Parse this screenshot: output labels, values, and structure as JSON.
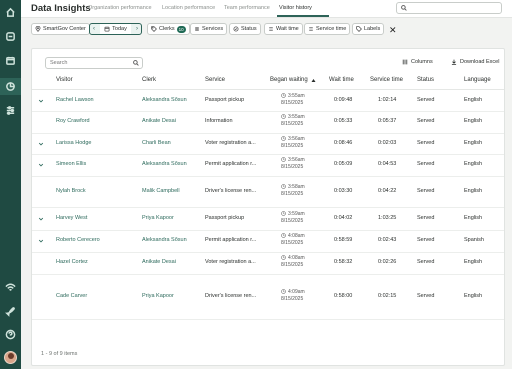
{
  "app": {
    "title": "Data Insights"
  },
  "tabs": [
    {
      "label": "Organization performance",
      "active": false
    },
    {
      "label": "Location performance",
      "active": false
    },
    {
      "label": "Team performance",
      "active": false
    },
    {
      "label": "Visitor history",
      "active": true
    }
  ],
  "filters": {
    "location": "SmartGov Center",
    "date": "Today",
    "clerks_label": "Clerks",
    "clerks_count": "10",
    "services": "Services",
    "status": "Status",
    "wait_time": "Wait time",
    "service_time": "Service time",
    "labels": "Labels",
    "clear": "✕"
  },
  "table_tools": {
    "search_placeholder": "Search",
    "columns_label": "Columns",
    "download_label": "Download Excel"
  },
  "columns": [
    "Visitor",
    "Clerk",
    "Service",
    "Began waiting",
    "Wait time",
    "Service time",
    "Status",
    "Language"
  ],
  "rows": [
    {
      "expandable": true,
      "visitor": "Rachel Lawson",
      "clerk": "Aleksandra Sõsun",
      "service": "Passport pickup",
      "time": "3:55am",
      "date": "8/15/2025",
      "wait": "0:09:48",
      "service_time": "1:02:14",
      "status": "Served",
      "language": "English"
    },
    {
      "expandable": false,
      "visitor": "Roy Crawford",
      "clerk": "Anikate Desai",
      "service": "Information",
      "time": "3:55am",
      "date": "8/15/2025",
      "wait": "0:05:33",
      "service_time": "0:05:37",
      "status": "Served",
      "language": "English"
    },
    {
      "expandable": true,
      "visitor": "Larissa Hodge",
      "clerk": "Charli Bean",
      "service": "Voter registration a...",
      "time": "3:56am",
      "date": "8/15/2025",
      "wait": "0:08:46",
      "service_time": "0:02:03",
      "status": "Served",
      "language": "English"
    },
    {
      "expandable": true,
      "visitor": "Simeon Ellis",
      "clerk": "Aleksandra Sõsun",
      "service": "Permit application r...",
      "time": "3:56am",
      "date": "8/15/2025",
      "wait": "0:05:09",
      "service_time": "0:04:53",
      "status": "Served",
      "language": "English"
    },
    {
      "expandable": false,
      "visitor": "Nylah Brock",
      "clerk": "Malik Campbell",
      "service": "Driver's license ren...",
      "time": "3:58am",
      "date": "8/15/2025",
      "wait": "0:03:30",
      "service_time": "0:04:22",
      "status": "Served",
      "language": "English"
    },
    {
      "expandable": true,
      "visitor": "Harvey West",
      "clerk": "Priya Kapoor",
      "service": "Passport pickup",
      "time": "3:59am",
      "date": "8/15/2025",
      "wait": "0:04:02",
      "service_time": "1:03:25",
      "status": "Served",
      "language": "English"
    },
    {
      "expandable": true,
      "visitor": "Roberto Cerecero",
      "clerk": "Aleksandra Sõsun",
      "service": "Permit application r...",
      "time": "4:08am",
      "date": "8/15/2025",
      "wait": "0:58:59",
      "service_time": "0:02:43",
      "status": "Served",
      "language": "Spanish"
    },
    {
      "expandable": false,
      "visitor": "Hazel Cortez",
      "clerk": "Anikate Desai",
      "service": "Voter registration a...",
      "time": "4:08am",
      "date": "8/15/2025",
      "wait": "0:58:32",
      "service_time": "0:02:26",
      "status": "Served",
      "language": "English"
    },
    {
      "expandable": false,
      "visitor": "Cade Carver",
      "clerk": "Priya Kapoor",
      "service": "Driver's license ren...",
      "time": "4:09am",
      "date": "8/15/2025",
      "wait": "0:58:00",
      "service_time": "0:02:15",
      "status": "Served",
      "language": "English"
    }
  ],
  "footer": {
    "count_text": "1 - 9 of 9 items"
  }
}
